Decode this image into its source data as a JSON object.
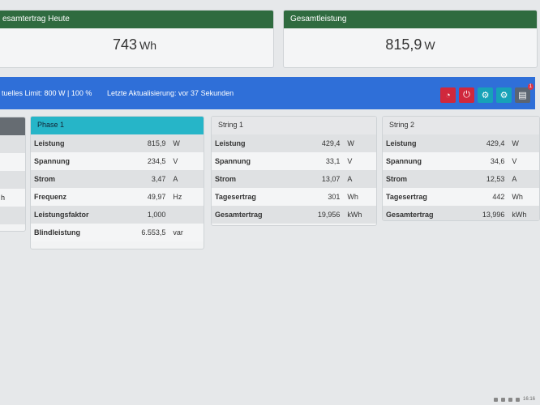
{
  "cards": {
    "today": {
      "title": "esamtertrag Heute",
      "value": "743",
      "unit": "Wh"
    },
    "total": {
      "title": "Gesamtleistung",
      "value": "815,9",
      "unit": "W"
    }
  },
  "status_bar": {
    "limit_text": "tuelles Limit: 800 W | 100 %",
    "update_text": "Letzte Aktualisierung: vor 37 Sekunden"
  },
  "left_panel": {
    "rows": [
      "",
      "",
      "",
      "h",
      ""
    ]
  },
  "phase1": {
    "title": "Phase 1",
    "rows": [
      {
        "label": "Leistung",
        "value": "815,9",
        "unit": "W"
      },
      {
        "label": "Spannung",
        "value": "234,5",
        "unit": "V"
      },
      {
        "label": "Strom",
        "value": "3,47",
        "unit": "A"
      },
      {
        "label": "Frequenz",
        "value": "49,97",
        "unit": "Hz"
      },
      {
        "label": "Leistungsfaktor",
        "value": "1,000",
        "unit": ""
      },
      {
        "label": "Blindleistung",
        "value": "6.553,5",
        "unit": "var"
      }
    ]
  },
  "string1": {
    "title": "String 1",
    "rows": [
      {
        "label": "Leistung",
        "value": "429,4",
        "unit": "W"
      },
      {
        "label": "Spannung",
        "value": "33,1",
        "unit": "V"
      },
      {
        "label": "Strom",
        "value": "13,07",
        "unit": "A"
      },
      {
        "label": "Tagesertrag",
        "value": "301",
        "unit": "Wh"
      },
      {
        "label": "Gesamtertrag",
        "value": "19,956",
        "unit": "kWh"
      }
    ]
  },
  "string2": {
    "title": "String 2",
    "rows": [
      {
        "label": "Leistung",
        "value": "429,4",
        "unit": "W"
      },
      {
        "label": "Spannung",
        "value": "34,6",
        "unit": "V"
      },
      {
        "label": "Strom",
        "value": "12,53",
        "unit": "A"
      },
      {
        "label": "Tagesertrag",
        "value": "442",
        "unit": "Wh"
      },
      {
        "label": "Gesamtertrag",
        "value": "13,996",
        "unit": "kWh"
      }
    ]
  },
  "toolbar_icons": [
    "gauge-icon",
    "power-icon",
    "settings-icon",
    "settings-icon",
    "document-icon"
  ],
  "notification_count": "1",
  "taskbar": {
    "time": "16:16"
  }
}
